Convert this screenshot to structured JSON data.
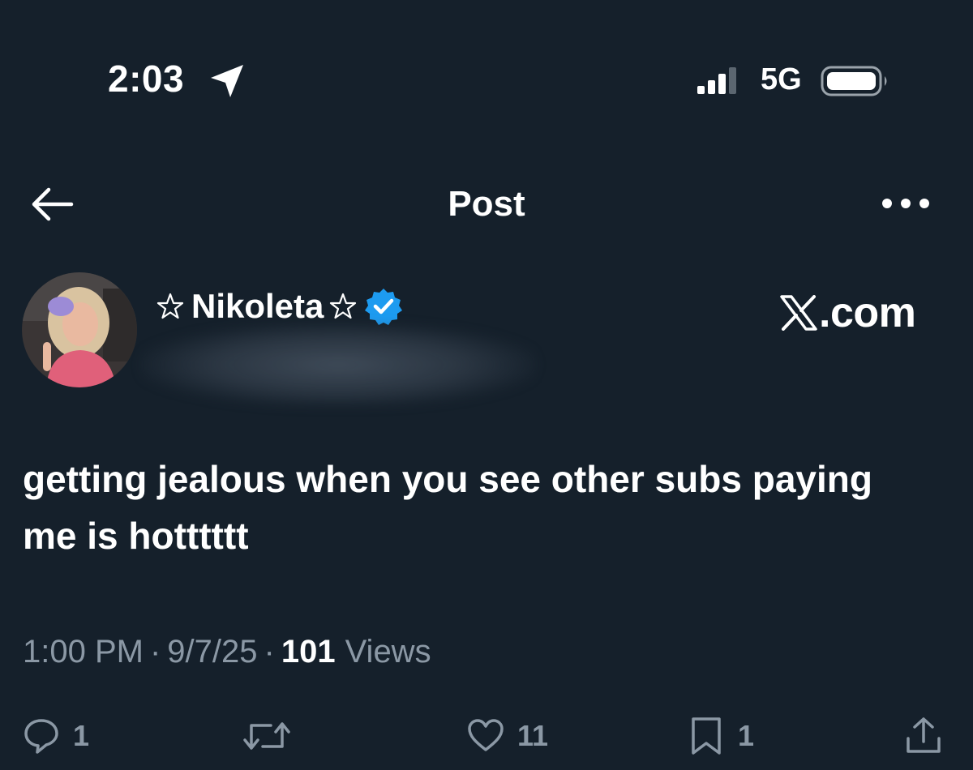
{
  "status_bar": {
    "time": "2:03",
    "network": "5G",
    "icons": [
      "location-arrow-icon",
      "signal-bars-icon",
      "battery-icon"
    ]
  },
  "nav": {
    "title": "Post",
    "back_icon": "arrow-left-icon",
    "more_icon": "more-dots-icon"
  },
  "author": {
    "display_name": "Nikoleta",
    "name_decoration_icon": "star-outline-icon",
    "verified_icon": "verified-badge-icon",
    "verified_color": "#1d9bf0"
  },
  "watermark": {
    "text": ".com",
    "logo": "x-logo-icon"
  },
  "post": {
    "text": "getting jealous when you see other subs paying me is hotttttt"
  },
  "meta": {
    "time": "1:00 PM",
    "separator": "·",
    "date": "9/7/25",
    "views_count": "101",
    "views_label": "Views"
  },
  "actions": {
    "reply_count": "1",
    "like_count": "11",
    "bookmark_count": "1"
  },
  "colors": {
    "background": "#15202b",
    "text_primary": "#ffffff",
    "text_secondary": "#8b98a5",
    "accent": "#1d9bf0"
  }
}
